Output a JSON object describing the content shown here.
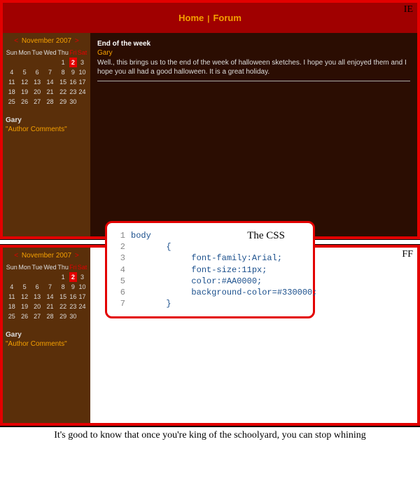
{
  "nav": {
    "home": "Home",
    "forum": "Forum",
    "sep": "|"
  },
  "labels": {
    "ie": "IE",
    "ff": "FF",
    "css_title": "The CSS"
  },
  "calendar": {
    "prev": "<",
    "next": ">",
    "month": "November 2007",
    "dow": [
      "Sun",
      "Mon",
      "Tue",
      "Wed",
      "Thu",
      "Fri",
      "Sat"
    ],
    "rows": [
      [
        "",
        "",
        "",
        "",
        "1",
        "2",
        "3"
      ],
      [
        "4",
        "5",
        "6",
        "7",
        "8",
        "9",
        "10"
      ],
      [
        "11",
        "12",
        "13",
        "14",
        "15",
        "16",
        "17"
      ],
      [
        "18",
        "19",
        "20",
        "21",
        "22",
        "23",
        "24"
      ],
      [
        "25",
        "26",
        "27",
        "28",
        "29",
        "30",
        ""
      ]
    ],
    "highlighted": "2"
  },
  "author": {
    "name": "Gary",
    "comments": "\"Author Comments\""
  },
  "post": {
    "title": "End of the week",
    "author": "Gary",
    "body": "Well., this brings us to the end of the week of halloween sketches. I hope you all enjoyed them and I hope you all had a good halloween. It is a great holiday."
  },
  "css": {
    "l1": "body",
    "l2": "       {",
    "l3": "            font-family:Arial;",
    "l4": "            font-size:11px;",
    "l5": "            color:#AA0000;",
    "l6": "            background-color=#330000;",
    "l7": "       }"
  },
  "caption": "It's good to know that once you're king of the schoolyard, you can stop whining"
}
